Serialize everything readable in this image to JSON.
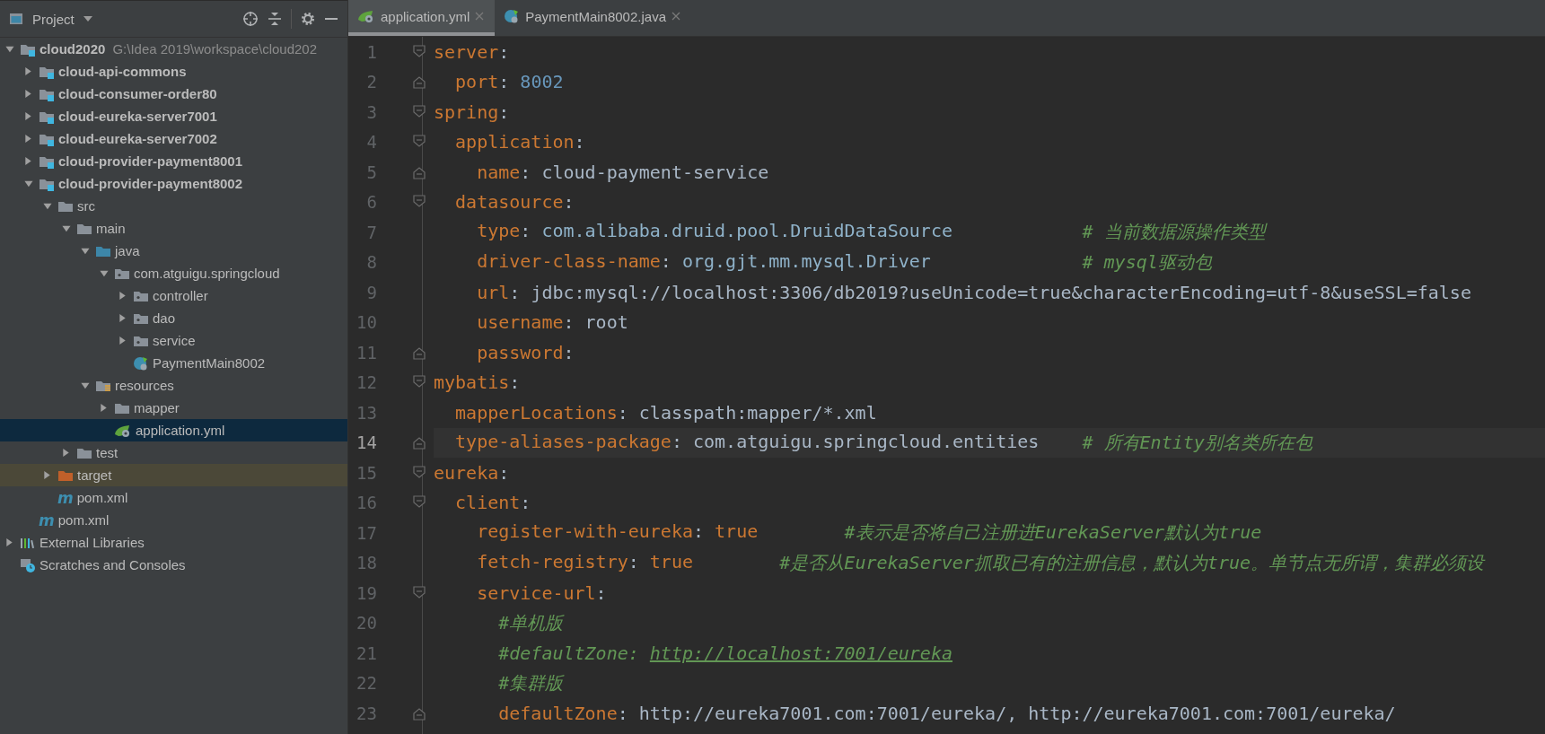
{
  "project": {
    "title": "Project",
    "tree": [
      {
        "label": "cloud2020",
        "kind": "module",
        "path": "G:\\Idea 2019\\workspace\\cloud202",
        "expanded": true,
        "selected": false,
        "children": [
          {
            "label": "cloud-api-commons",
            "kind": "module",
            "expanded": false,
            "selected": false
          },
          {
            "label": "cloud-consumer-order80",
            "kind": "module",
            "expanded": false,
            "selected": false
          },
          {
            "label": "cloud-eureka-server7001",
            "kind": "module",
            "expanded": false,
            "selected": false
          },
          {
            "label": "cloud-eureka-server7002",
            "kind": "module",
            "expanded": false,
            "selected": false
          },
          {
            "label": "cloud-provider-payment8001",
            "kind": "module",
            "expanded": false,
            "selected": false
          },
          {
            "label": "cloud-provider-payment8002",
            "kind": "module",
            "expanded": true,
            "selected": false,
            "children": [
              {
                "label": "src",
                "kind": "folder",
                "expanded": true,
                "selected": false,
                "children": [
                  {
                    "label": "main",
                    "kind": "folder",
                    "expanded": true,
                    "selected": false,
                    "children": [
                      {
                        "label": "java",
                        "kind": "source",
                        "expanded": true,
                        "selected": false,
                        "children": [
                          {
                            "label": "com.atguigu.springcloud",
                            "kind": "package",
                            "expanded": true,
                            "selected": false,
                            "children": [
                              {
                                "label": "controller",
                                "kind": "package",
                                "expanded": false,
                                "selected": false
                              },
                              {
                                "label": "dao",
                                "kind": "package",
                                "expanded": false,
                                "selected": false
                              },
                              {
                                "label": "service",
                                "kind": "package",
                                "expanded": false,
                                "selected": false
                              },
                              {
                                "label": "PaymentMain8002",
                                "kind": "spring-class",
                                "selected": false
                              }
                            ]
                          }
                        ]
                      },
                      {
                        "label": "resources",
                        "kind": "resources",
                        "expanded": true,
                        "selected": false,
                        "children": [
                          {
                            "label": "mapper",
                            "kind": "folder",
                            "expanded": false,
                            "selected": false
                          },
                          {
                            "label": "application.yml",
                            "kind": "yml",
                            "selected": true
                          }
                        ]
                      }
                    ]
                  },
                  {
                    "label": "test",
                    "kind": "folder",
                    "expanded": false,
                    "selected": false
                  }
                ]
              },
              {
                "label": "target",
                "kind": "excluded",
                "expanded": false,
                "selected": false
              },
              {
                "label": "pom.xml",
                "kind": "maven",
                "icon_text": "m",
                "selected": false
              }
            ]
          },
          {
            "label": "pom.xml",
            "kind": "maven",
            "icon_text": "m",
            "selected": false
          }
        ]
      },
      {
        "label": "External Libraries",
        "kind": "libraries",
        "expanded": false,
        "selected": false
      },
      {
        "label": "Scratches and Consoles",
        "kind": "scratches",
        "selected": false
      }
    ]
  },
  "editor": {
    "tabs": [
      {
        "label": "application.yml",
        "kind": "yml",
        "selected": true
      },
      {
        "label": "PaymentMain8002.java",
        "kind": "spring-class",
        "selected": false
      }
    ],
    "lines": [
      {
        "number": "1",
        "current": false,
        "segments": [
          {
            "kind": "key",
            "text": "server"
          },
          {
            "kind": "punct",
            "text": ":"
          }
        ],
        "children": [
          {
            "number": "2",
            "current": false,
            "segments": [
              {
                "kind": "key",
                "text": "port"
              },
              {
                "kind": "punct",
                "text": ": "
              },
              {
                "kind": "number",
                "text": "8002"
              }
            ]
          }
        ]
      },
      {
        "number": "3",
        "current": false,
        "segments": [
          {
            "kind": "key",
            "text": "spring"
          },
          {
            "kind": "punct",
            "text": ":"
          }
        ],
        "children": [
          {
            "number": "4",
            "current": false,
            "segments": [
              {
                "kind": "key",
                "text": "application"
              },
              {
                "kind": "punct",
                "text": ":"
              }
            ],
            "children": [
              {
                "number": "5",
                "current": false,
                "segments": [
                  {
                    "kind": "key",
                    "text": "name"
                  },
                  {
                    "kind": "punct",
                    "text": ": "
                  },
                  {
                    "kind": "text",
                    "text": "cloud-payment-service"
                  }
                ]
              }
            ]
          },
          {
            "number": "6",
            "current": false,
            "segments": [
              {
                "kind": "key",
                "text": "datasource"
              },
              {
                "kind": "punct",
                "text": ":"
              }
            ],
            "children": [
              {
                "number": "7",
                "current": false,
                "segments": [
                  {
                    "kind": "key",
                    "text": "type"
                  },
                  {
                    "kind": "punct",
                    "text": ": "
                  },
                  {
                    "kind": "class",
                    "text": "com.alibaba.druid.pool.DruidDataSource"
                  },
                  {
                    "kind": "comment",
                    "text": "            # 当前数据源操作类型"
                  }
                ]
              },
              {
                "number": "8",
                "current": false,
                "segments": [
                  {
                    "kind": "key",
                    "text": "driver-class-name"
                  },
                  {
                    "kind": "punct",
                    "text": ": "
                  },
                  {
                    "kind": "class",
                    "text": "org.gjt.mm.mysql.Driver"
                  },
                  {
                    "kind": "comment",
                    "text": "              # mysql驱动包"
                  }
                ]
              },
              {
                "number": "9",
                "current": false,
                "segments": [
                  {
                    "kind": "key",
                    "text": "url"
                  },
                  {
                    "kind": "punct",
                    "text": ": "
                  },
                  {
                    "kind": "text",
                    "text": "jdbc:mysql://localhost:3306/db2019?useUnicode=true&characterEncoding=utf-8&useSSL=false"
                  }
                ]
              },
              {
                "number": "10",
                "current": false,
                "segments": [
                  {
                    "kind": "key",
                    "text": "username"
                  },
                  {
                    "kind": "punct",
                    "text": ": "
                  },
                  {
                    "kind": "text",
                    "text": "root"
                  }
                ]
              },
              {
                "number": "11",
                "current": false,
                "segments": [
                  {
                    "kind": "key",
                    "text": "password"
                  },
                  {
                    "kind": "punct",
                    "text": ":"
                  }
                ]
              }
            ]
          }
        ]
      },
      {
        "number": "12",
        "current": false,
        "segments": [
          {
            "kind": "key",
            "text": "mybatis"
          },
          {
            "kind": "punct",
            "text": ":"
          }
        ],
        "children": [
          {
            "number": "13",
            "current": false,
            "segments": [
              {
                "kind": "key",
                "text": "mapperLocations"
              },
              {
                "kind": "punct",
                "text": ": "
              },
              {
                "kind": "text",
                "text": "classpath:mapper/*.xml"
              }
            ]
          },
          {
            "number": "14",
            "current": true,
            "segments": [
              {
                "kind": "key",
                "text": "type-aliases-package"
              },
              {
                "kind": "punct",
                "text": ": "
              },
              {
                "kind": "text",
                "text": "com.atguigu.springcloud.entities"
              },
              {
                "kind": "comment",
                "text": "    # 所有Entity别名类所在包"
              }
            ]
          }
        ]
      },
      {
        "number": "15",
        "current": false,
        "segments": [
          {
            "kind": "key",
            "text": "eureka"
          },
          {
            "kind": "punct",
            "text": ":"
          }
        ],
        "children": [
          {
            "number": "16",
            "current": false,
            "segments": [
              {
                "kind": "key",
                "text": "client"
              },
              {
                "kind": "punct",
                "text": ":"
              }
            ],
            "children": [
              {
                "number": "17",
                "current": false,
                "segments": [
                  {
                    "kind": "key",
                    "text": "register-with-eureka"
                  },
                  {
                    "kind": "punct",
                    "text": ": "
                  },
                  {
                    "kind": "keyword",
                    "text": "true"
                  },
                  {
                    "kind": "comment",
                    "text": "        #表示是否将自己注册进EurekaServer默认为true"
                  }
                ]
              },
              {
                "number": "18",
                "current": false,
                "segments": [
                  {
                    "kind": "key",
                    "text": "fetch-registry"
                  },
                  {
                    "kind": "punct",
                    "text": ": "
                  },
                  {
                    "kind": "keyword",
                    "text": "true"
                  },
                  {
                    "kind": "comment",
                    "text": "        #是否从EurekaServer抓取已有的注册信息，默认为true。单节点无所谓，集群必须设"
                  }
                ]
              },
              {
                "number": "19",
                "current": false,
                "segments": [
                  {
                    "kind": "key",
                    "text": "service-url"
                  },
                  {
                    "kind": "punct",
                    "text": ":"
                  }
                ],
                "children": [
                  {
                    "number": "20",
                    "current": false,
                    "segments": [
                      {
                        "kind": "comment",
                        "text": "#单机版"
                      }
                    ]
                  },
                  {
                    "number": "21",
                    "current": false,
                    "segments": [
                      {
                        "kind": "comment",
                        "text": "#defaultZone: "
                      },
                      {
                        "kind": "link",
                        "text": "http://localhost:7001/eureka"
                      }
                    ]
                  },
                  {
                    "number": "22",
                    "current": false,
                    "segments": [
                      {
                        "kind": "comment",
                        "text": "#集群版"
                      }
                    ]
                  },
                  {
                    "number": "23",
                    "current": false,
                    "segments": [
                      {
                        "kind": "key",
                        "text": "defaultZone"
                      },
                      {
                        "kind": "punct",
                        "text": ": "
                      },
                      {
                        "kind": "text",
                        "text": "http://eureka7001.com:7001/eureka/, http://eureka7001.com:7001/eureka/"
                      }
                    ]
                  }
                ]
              }
            ]
          }
        ]
      }
    ]
  }
}
